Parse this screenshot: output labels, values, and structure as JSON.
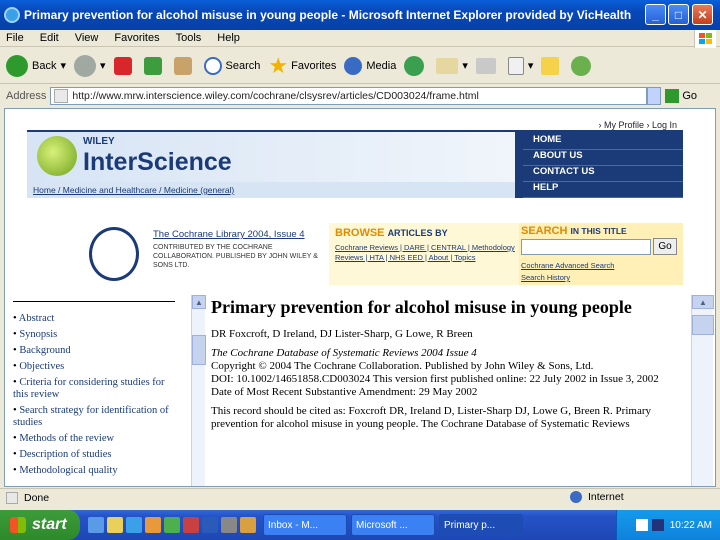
{
  "window": {
    "title": "Primary prevention for alcohol misuse in young people - Microsoft Internet Explorer provided by VicHealth",
    "min": "_",
    "max": "□",
    "close": "✕"
  },
  "menu": [
    "File",
    "Edit",
    "View",
    "Favorites",
    "Tools",
    "Help"
  ],
  "toolbar": {
    "back": "Back",
    "search": "Search",
    "favorites": "Favorites",
    "media": "Media"
  },
  "address": {
    "label": "Address",
    "url": "http://www.mrw.interscience.wiley.com/cochrane/clsysrev/articles/CD003024/frame.html",
    "go": "Go"
  },
  "site": {
    "brand_small": "WILEY",
    "brand": "InterScience",
    "util": "› My Profile  › Log In",
    "nav": [
      "HOME",
      "ABOUT US",
      "CONTACT US",
      "HELP"
    ],
    "breadcrumb": "Home / Medicine and Healthcare / Medicine (general)"
  },
  "library": {
    "title": "The Cochrane Library 2004, Issue 4",
    "small": "CONTRIBUTED BY THE COCHRANE COLLABORATION. PUBLISHED BY JOHN WILEY & SONS LTD.",
    "browse": "BROWSE",
    "browse_sub": "ARTICLES BY",
    "browse_links": "Cochrane Reviews | DARE | CENTRAL | Methodology Reviews | HTA | NHS EED | About | Topics",
    "search": "SEARCH",
    "search_sub": "IN THIS TITLE",
    "go": "Go",
    "adv": "Cochrane Advanced Search",
    "history": "Search History"
  },
  "toc": [
    "Abstract",
    "Synopsis",
    "Background",
    "Objectives",
    "Criteria for considering studies for this review",
    "Search strategy for identification of studies",
    "Methods of the review",
    "Description of studies",
    "Methodological quality"
  ],
  "article": {
    "title": "Primary prevention for alcohol misuse in young people",
    "authors": "DR Foxcroft, D Ireland, DJ Lister-Sharp, G Lowe, R Breen",
    "citation": "The Cochrane Database of Systematic Reviews 2004 Issue 4",
    "copyright": "Copyright © 2004 The Cochrane Collaboration. Published by John Wiley & Sons, Ltd.",
    "doi": "DOI: 10.1002/14651858.CD003024  This version first published online: 22 July 2002 in Issue 3, 2002",
    "amended": "Date of Most Recent Substantive Amendment: 29 May 2002",
    "cite_as": "This record should be cited as: Foxcroft DR, Ireland D, Lister-Sharp DJ, Lowe G, Breen R. Primary prevention for alcohol misuse in young people. The Cochrane Database of Systematic Reviews"
  },
  "status": {
    "text": "Done",
    "zone": "Internet"
  },
  "taskbar": {
    "start": "start",
    "tasks": [
      "Inbox - M...",
      "Microsoft ...",
      "Primary p..."
    ],
    "time": "10:22 AM"
  }
}
